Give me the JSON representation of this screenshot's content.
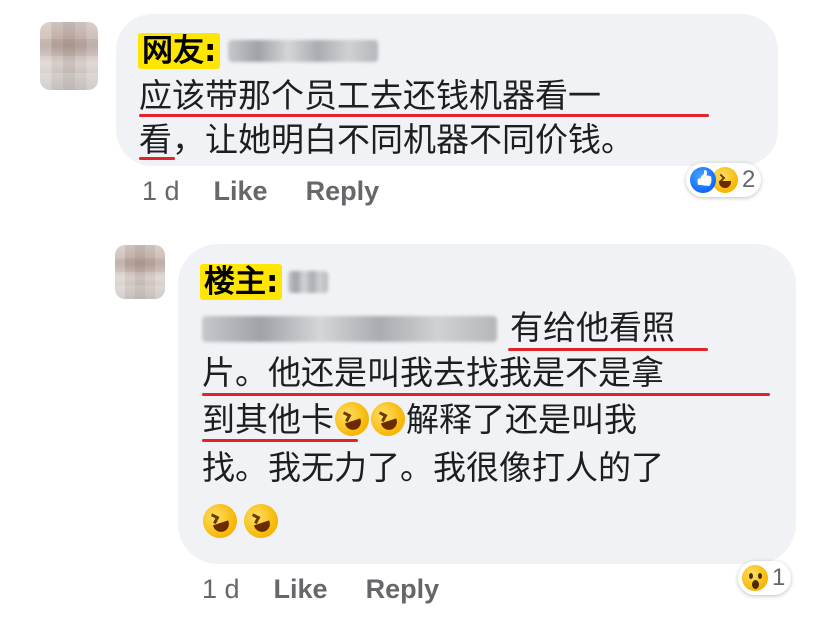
{
  "comments": [
    {
      "tag": "网友:",
      "lines": [
        "应该带那个员工去还钱机器看一",
        "看，让她明白不同机器不同价钱。"
      ],
      "time": "1 d",
      "like_label": "Like",
      "reply_label": "Reply",
      "reactions": {
        "icons": [
          "like-icon",
          "laugh-icon"
        ],
        "count": "2"
      }
    },
    {
      "tag": "楼主:",
      "lines": [
        "有给他看照",
        "片。他还是叫我去找我是不是拿",
        "到其他卡",
        "解释了还是叫我",
        "找。我无力了。我很像打人的了"
      ],
      "time": "1 d",
      "like_label": "Like",
      "reply_label": "Reply",
      "reactions": {
        "icons": [
          "wow-icon"
        ],
        "count": "1"
      }
    }
  ],
  "colors": {
    "bubble": "#f0f2f5",
    "highlight": "#ffe600",
    "underline": "#e0242a",
    "meta_text": "#65676b"
  }
}
